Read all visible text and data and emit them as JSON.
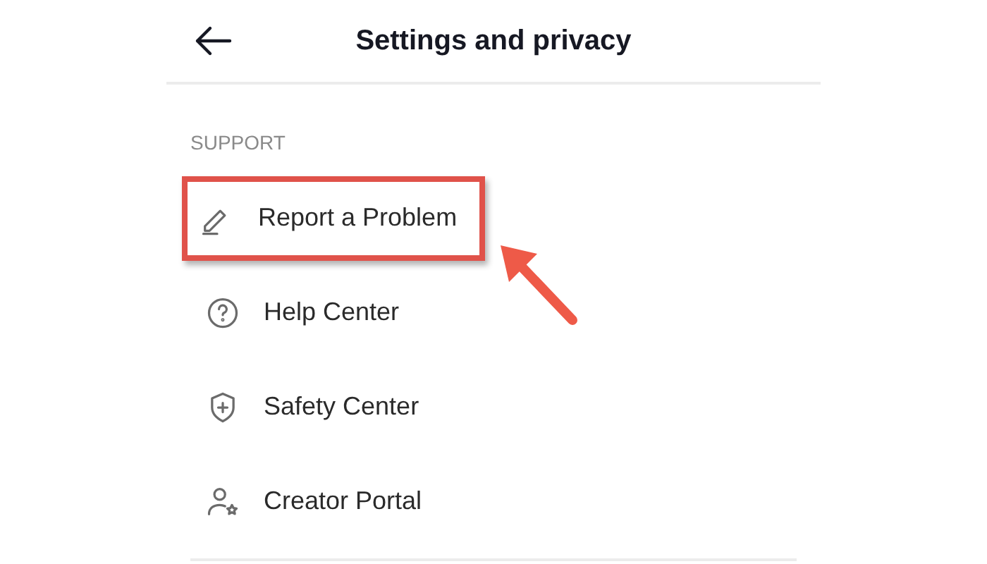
{
  "header": {
    "title": "Settings and privacy"
  },
  "section": {
    "heading": "SUPPORT",
    "items": [
      {
        "label": "Report a Problem",
        "kind": "pencil",
        "highlighted": true
      },
      {
        "label": "Help Center",
        "kind": "question",
        "highlighted": false
      },
      {
        "label": "Safety Center",
        "kind": "shield",
        "highlighted": false
      },
      {
        "label": "Creator Portal",
        "kind": "creator",
        "highlighted": false
      }
    ]
  }
}
